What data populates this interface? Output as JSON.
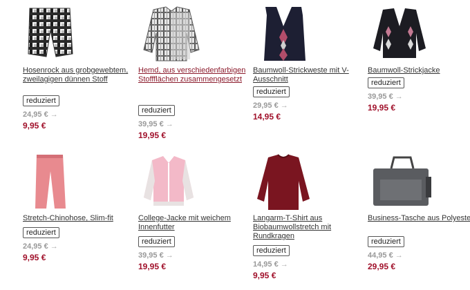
{
  "products": [
    {
      "title": "Hosenrock aus grobgewebtem, zweilagigen dünnen Stoff",
      "badge": "reduziert",
      "old_price": "24,95 €",
      "new_price": "9,95 €",
      "image": "plaid-skirt-shorts-icon"
    },
    {
      "title": "Hemd, aus verschiedenfarbigen Stoffflächen zusammengesetzt",
      "badge": "reduziert",
      "old_price": "39,95 €",
      "new_price": "19,95 €",
      "image": "plaid-shirt-icon"
    },
    {
      "title": "Baumwoll-Strickweste mit V-Ausschnitt",
      "badge": "reduziert",
      "old_price": "29,95 €",
      "new_price": "14,95 €",
      "image": "argyle-vest-icon"
    },
    {
      "title": "Baumwoll-Strickjacke",
      "badge": "reduziert",
      "old_price": "39,95 €",
      "new_price": "19,95 €",
      "image": "argyle-cardigan-icon"
    },
    {
      "title": "Stretch-Chinohose, Slim-fit",
      "badge": "reduziert",
      "old_price": "24,95 €",
      "new_price": "9,95 €",
      "image": "pink-chinos-icon"
    },
    {
      "title": "College-Jacke mit weichem Innenfutter",
      "badge": "reduziert",
      "old_price": "39,95 €",
      "new_price": "19,95 €",
      "image": "college-jacket-icon"
    },
    {
      "title": "Langarm-T-Shirt aus Biobaumwollstretch mit Rundkragen",
      "badge": "reduziert",
      "old_price": "14,95 €",
      "new_price": "9,95 €",
      "image": "longsleeve-shirt-icon"
    },
    {
      "title": "Business-Tasche aus Polyester",
      "badge": "reduziert",
      "old_price": "44,95 €",
      "new_price": "29,95 €",
      "image": "business-bag-icon"
    }
  ],
  "price_arrow": "→",
  "colors": {
    "price_new": "#a0102a",
    "price_old": "#999999",
    "link_highlight": "#8b1a2b"
  }
}
